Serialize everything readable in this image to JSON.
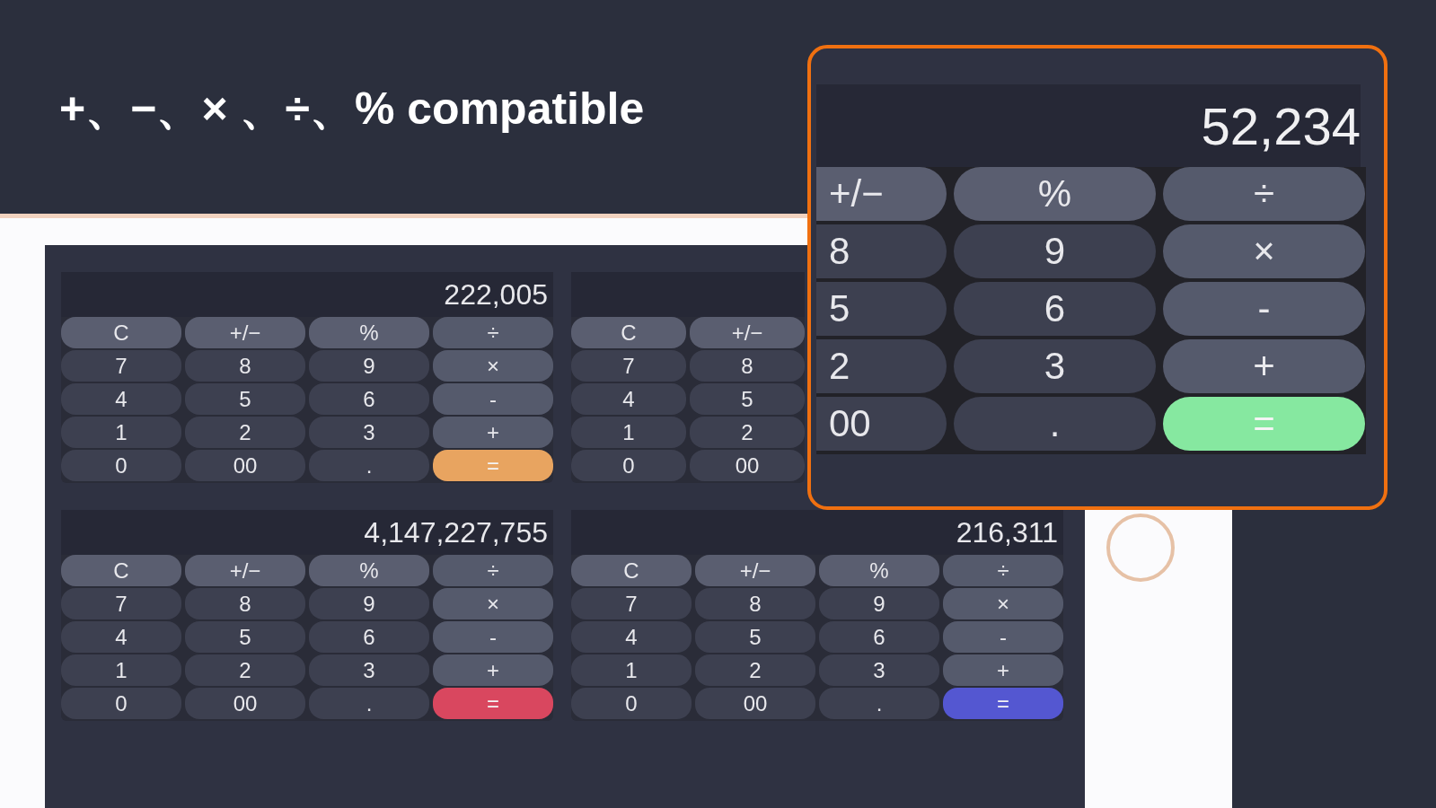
{
  "headline": "+、−、× 、÷、% compatible",
  "calculators": [
    {
      "display": "222,005",
      "keys": [
        {
          "label": "C",
          "kind": "func"
        },
        {
          "label": "+/−",
          "kind": "func"
        },
        {
          "label": "%",
          "kind": "func"
        },
        {
          "label": "÷",
          "kind": "op"
        },
        {
          "label": "7",
          "kind": "digit"
        },
        {
          "label": "8",
          "kind": "digit"
        },
        {
          "label": "9",
          "kind": "digit"
        },
        {
          "label": "×",
          "kind": "op"
        },
        {
          "label": "4",
          "kind": "digit"
        },
        {
          "label": "5",
          "kind": "digit"
        },
        {
          "label": "6",
          "kind": "digit"
        },
        {
          "label": "-",
          "kind": "op"
        },
        {
          "label": "1",
          "kind": "digit"
        },
        {
          "label": "2",
          "kind": "digit"
        },
        {
          "label": "3",
          "kind": "digit"
        },
        {
          "label": "+",
          "kind": "op"
        },
        {
          "label": "0",
          "kind": "digit"
        },
        {
          "label": "00",
          "kind": "digit"
        },
        {
          "label": ".",
          "kind": "digit"
        },
        {
          "label": "=",
          "kind": "equals",
          "color": "#e8a460"
        }
      ]
    },
    {
      "keys": [
        {
          "label": "C",
          "kind": "func"
        },
        {
          "label": "+/−",
          "kind": "func"
        },
        {
          "label": "7",
          "kind": "digit"
        },
        {
          "label": "8",
          "kind": "digit"
        },
        {
          "label": "4",
          "kind": "digit"
        },
        {
          "label": "5",
          "kind": "digit"
        },
        {
          "label": "1",
          "kind": "digit"
        },
        {
          "label": "2",
          "kind": "digit"
        },
        {
          "label": "0",
          "kind": "digit"
        },
        {
          "label": "00",
          "kind": "digit"
        }
      ]
    },
    {
      "display": "4,147,227,755",
      "keys": [
        {
          "label": "C",
          "kind": "func"
        },
        {
          "label": "+/−",
          "kind": "func"
        },
        {
          "label": "%",
          "kind": "func"
        },
        {
          "label": "÷",
          "kind": "op"
        },
        {
          "label": "7",
          "kind": "digit"
        },
        {
          "label": "8",
          "kind": "digit"
        },
        {
          "label": "9",
          "kind": "digit"
        },
        {
          "label": "×",
          "kind": "op"
        },
        {
          "label": "4",
          "kind": "digit"
        },
        {
          "label": "5",
          "kind": "digit"
        },
        {
          "label": "6",
          "kind": "digit"
        },
        {
          "label": "-",
          "kind": "op"
        },
        {
          "label": "1",
          "kind": "digit"
        },
        {
          "label": "2",
          "kind": "digit"
        },
        {
          "label": "3",
          "kind": "digit"
        },
        {
          "label": "+",
          "kind": "op"
        },
        {
          "label": "0",
          "kind": "digit"
        },
        {
          "label": "00",
          "kind": "digit"
        },
        {
          "label": ".",
          "kind": "digit"
        },
        {
          "label": "=",
          "kind": "equals",
          "color": "#d9475f"
        }
      ]
    },
    {
      "display": "216,311",
      "keys": [
        {
          "label": "C",
          "kind": "func"
        },
        {
          "label": "+/−",
          "kind": "func"
        },
        {
          "label": "%",
          "kind": "func"
        },
        {
          "label": "÷",
          "kind": "op"
        },
        {
          "label": "7",
          "kind": "digit"
        },
        {
          "label": "8",
          "kind": "digit"
        },
        {
          "label": "9",
          "kind": "digit"
        },
        {
          "label": "×",
          "kind": "op"
        },
        {
          "label": "4",
          "kind": "digit"
        },
        {
          "label": "5",
          "kind": "digit"
        },
        {
          "label": "6",
          "kind": "digit"
        },
        {
          "label": "-",
          "kind": "op"
        },
        {
          "label": "1",
          "kind": "digit"
        },
        {
          "label": "2",
          "kind": "digit"
        },
        {
          "label": "3",
          "kind": "digit"
        },
        {
          "label": "+",
          "kind": "op"
        },
        {
          "label": "0",
          "kind": "digit"
        },
        {
          "label": "00",
          "kind": "digit"
        },
        {
          "label": ".",
          "kind": "digit"
        },
        {
          "label": "=",
          "kind": "equals",
          "color": "#5457d1"
        }
      ]
    }
  ],
  "zoom_callout": {
    "display": "52,234",
    "keys": [
      {
        "label": "+/−",
        "kind": "func"
      },
      {
        "label": "%",
        "kind": "func"
      },
      {
        "label": "÷",
        "kind": "op"
      },
      {
        "label": "8",
        "kind": "digit"
      },
      {
        "label": "9",
        "kind": "digit"
      },
      {
        "label": "×",
        "kind": "op"
      },
      {
        "label": "5",
        "kind": "digit"
      },
      {
        "label": "6",
        "kind": "digit"
      },
      {
        "label": "-",
        "kind": "op"
      },
      {
        "label": "2",
        "kind": "digit"
      },
      {
        "label": "3",
        "kind": "digit"
      },
      {
        "label": "+",
        "kind": "op"
      },
      {
        "label": "00",
        "kind": "digit"
      },
      {
        "label": ".",
        "kind": "digit"
      },
      {
        "label": "=",
        "kind": "equals",
        "color": "#86e8a0"
      }
    ]
  }
}
